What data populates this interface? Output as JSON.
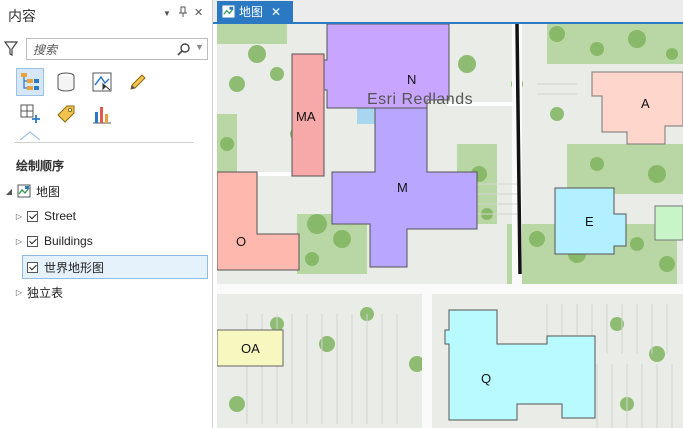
{
  "pane": {
    "title": "内容",
    "menu_glyph": "▼",
    "pin_glyph": "ᵖ",
    "close_glyph": "✕"
  },
  "search": {
    "placeholder": "搜索",
    "value": ""
  },
  "tools": [
    {
      "name": "list-by-drawing-order-icon"
    },
    {
      "name": "list-by-data-source-icon"
    },
    {
      "name": "list-by-selection-icon"
    },
    {
      "name": "list-by-editing-icon"
    },
    {
      "name": "list-by-snapping-icon"
    },
    {
      "name": "list-by-labeling-icon"
    },
    {
      "name": "list-by-charts-icon"
    }
  ],
  "tree": {
    "heading": "绘制顺序",
    "map_label": "地图",
    "layers": [
      {
        "label": "Street",
        "checked": true
      },
      {
        "label": "Buildings",
        "checked": true
      },
      {
        "label": "世界地形图",
        "checked": true
      }
    ],
    "standalone": "独立表"
  },
  "tab": {
    "label": "地图",
    "close": "✕"
  },
  "map": {
    "place_label": "Esri Redlands",
    "buildings": [
      {
        "label": "N",
        "color": "#c8a6ff"
      },
      {
        "label": "MA",
        "color": "#f7a8a8"
      },
      {
        "label": "M",
        "color": "#b8a6ff"
      },
      {
        "label": "O",
        "color": "#ffb8ae"
      },
      {
        "label": "A",
        "color": "#ffd6cc"
      },
      {
        "label": "E",
        "color": "#b3f0ff"
      },
      {
        "label": "OA",
        "color": "#f7f7c0"
      },
      {
        "label": "Q",
        "color": "#b8faff"
      }
    ]
  },
  "colors": {
    "accent": "#2b79c2",
    "selection": "#e5f1fb"
  }
}
